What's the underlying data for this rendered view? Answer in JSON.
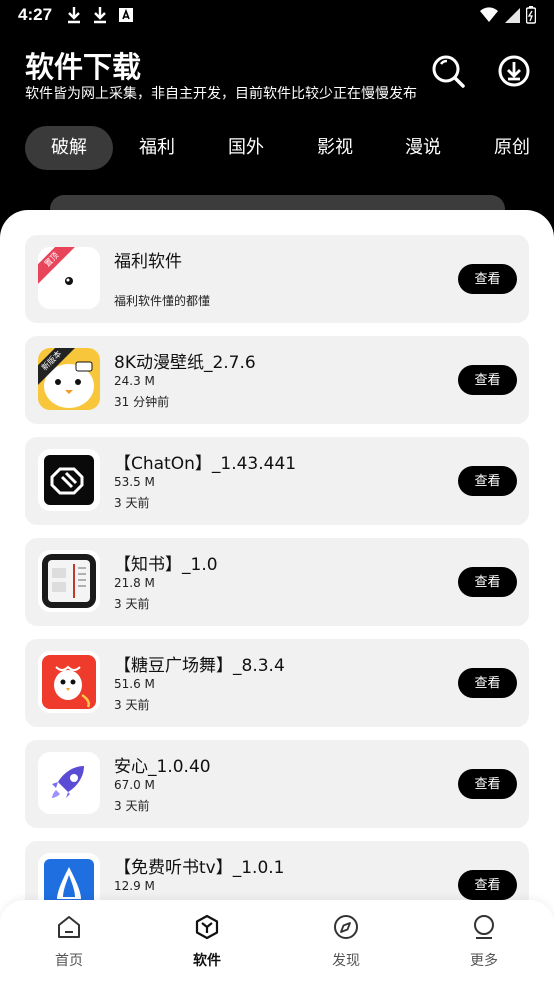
{
  "status_bar": {
    "time": "4:27"
  },
  "header": {
    "title": "软件下载",
    "subtitle": "软件皆为网上采集，非自主开发，目前软件比较少正在慢慢发布"
  },
  "tabs": [
    "破解",
    "福利",
    "国外",
    "影视",
    "漫说",
    "原创"
  ],
  "active_tab": "破解",
  "apps": [
    {
      "title": "福利软件",
      "line1": "",
      "line2": "福利软件懂的都懂",
      "button": "查看",
      "ribbon": "置顶",
      "icon": "welfare-app-icon"
    },
    {
      "title": "8K动漫壁纸_2.7.6",
      "line1": "24.3 M",
      "line2": "31 分钟前",
      "button": "查看",
      "ribbon": "新版本",
      "icon": "anime-wallpaper-icon"
    },
    {
      "title": "【ChatOn】_1.43.441",
      "line1": "53.5 M",
      "line2": "3 天前",
      "button": "查看",
      "icon": "chaton-icon"
    },
    {
      "title": "【知书】_1.0",
      "line1": "21.8 M",
      "line2": "3 天前",
      "button": "查看",
      "icon": "zhishu-book-icon"
    },
    {
      "title": "【糖豆广场舞】_8.3.4",
      "line1": "51.6 M",
      "line2": "3 天前",
      "button": "查看",
      "icon": "tangdou-icon"
    },
    {
      "title": "安心_1.0.40",
      "line1": "67.0 M",
      "line2": "3 天前",
      "button": "查看",
      "icon": "rocket-icon"
    },
    {
      "title": "【免费听书tv】_1.0.1",
      "line1": "12.9 M",
      "line2": "",
      "button": "查看",
      "icon": "audiobook-tv-icon"
    }
  ],
  "bottom_nav": [
    {
      "label": "首页",
      "icon": "home-icon"
    },
    {
      "label": "软件",
      "icon": "cube-icon"
    },
    {
      "label": "发现",
      "icon": "compass-icon"
    },
    {
      "label": "更多",
      "icon": "user-icon"
    }
  ],
  "active_nav": "软件"
}
